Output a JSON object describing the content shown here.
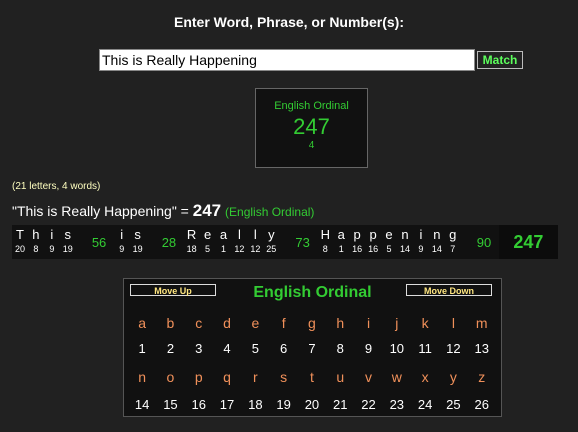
{
  "prompt": "Enter Word, Phrase, or Number(s):",
  "search": {
    "value": "This is Really Happening"
  },
  "match_label": "Match",
  "result": {
    "cipher": "English Ordinal",
    "value": "247",
    "words": "4"
  },
  "stats": "(21 letters, 4 words)",
  "phrase_line": {
    "quoted": "\"This is Really Happening\"",
    "equals": " = ",
    "total": "247",
    "cipher": "(English Ordinal)"
  },
  "breakdown": {
    "words": [
      {
        "letters": [
          "T",
          "h",
          "i",
          "s"
        ],
        "nums": [
          "20",
          "8",
          "9",
          "19"
        ],
        "sum": "56"
      },
      {
        "letters": [
          "i",
          "s"
        ],
        "nums": [
          "9",
          "19"
        ],
        "sum": "28"
      },
      {
        "letters": [
          "R",
          "e",
          "a",
          "l",
          "l",
          "y"
        ],
        "nums": [
          "18",
          "5",
          "1",
          "12",
          "12",
          "25"
        ],
        "sum": "73"
      },
      {
        "letters": [
          "H",
          "a",
          "p",
          "p",
          "e",
          "n",
          "i",
          "n",
          "g"
        ],
        "nums": [
          "8",
          "1",
          "16",
          "16",
          "5",
          "14",
          "9",
          "14",
          "7"
        ],
        "sum": "90"
      }
    ],
    "total": "247"
  },
  "cipher_panel": {
    "title": "English Ordinal",
    "move_up": "Move Up",
    "move_down": "Move Down",
    "row1_letters": [
      "a",
      "b",
      "c",
      "d",
      "e",
      "f",
      "g",
      "h",
      "i",
      "j",
      "k",
      "l",
      "m"
    ],
    "row1_numbers": [
      "1",
      "2",
      "3",
      "4",
      "5",
      "6",
      "7",
      "8",
      "9",
      "10",
      "11",
      "12",
      "13"
    ],
    "row2_letters": [
      "n",
      "o",
      "p",
      "q",
      "r",
      "s",
      "t",
      "u",
      "v",
      "w",
      "x",
      "y",
      "z"
    ],
    "row2_numbers": [
      "14",
      "15",
      "16",
      "17",
      "18",
      "19",
      "20",
      "21",
      "22",
      "23",
      "24",
      "25",
      "26"
    ]
  },
  "colors": {
    "accent_green": "#33cc33",
    "match_green": "#5cff5c",
    "letter_orange": "#f0905a",
    "move_yellow": "#ffe680"
  }
}
